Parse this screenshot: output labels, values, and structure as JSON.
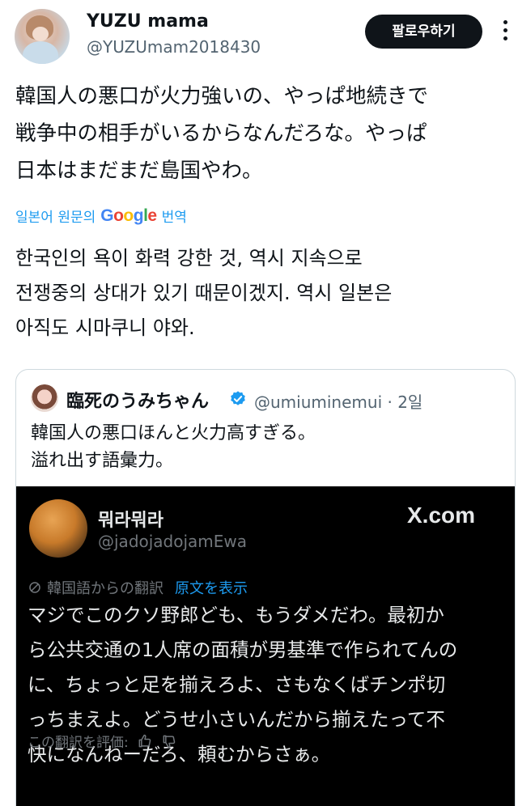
{
  "author": {
    "display_name": "YUZU mama",
    "handle": "@YUZUmam2018430",
    "follow_label": "팔로우하기"
  },
  "tweet": {
    "text_lines": [
      "韓国人の悪口が火力強いの、やっぱ地続きで",
      "戦争中の相手がいるからなんだろな。やっぱ",
      "日本はまだまだ島国やわ。"
    ],
    "translate_prefix": "일본어 원문의",
    "translate_suffix": "번역",
    "google": [
      "G",
      "o",
      "o",
      "g",
      "l",
      "e"
    ],
    "translated_lines": [
      "한국인의 욕이 화력 강한 것, 역시 지속으로",
      "전쟁중의 상대가 있기 때문이겠지. 역시 일본은",
      "아직도 시마쿠니 야와."
    ]
  },
  "quote": {
    "name": "臨死のうみちゃん",
    "handle_time": "@umiuminemui · 2일",
    "text_lines": [
      "韓国人の悪口ほんと火力高すぎる。",
      "溢れ出す語彙力。"
    ],
    "embedded": {
      "name": "뭐라뭐라",
      "handle": "@jadojadojamEwa",
      "site": "X.com",
      "translated_from": "韓国語からの翻訳",
      "show_original": "原文を表示",
      "body_lines": [
        "マジでこのクソ野郎ども、もうダメだわ。最初か",
        "ら公共交通の1人席の面積が男基準で作られてんの",
        "に、ちょっと足を揃えろよ、さもなくばチンポ切",
        "っちまえよ。どうせ小さいんだから揃えたって不",
        "快になんねーだろ、頼むからさぁ。"
      ],
      "rate_label": "この翻訳を評価:"
    }
  },
  "colors": {
    "link": "#1d9bf0",
    "muted": "#536471",
    "follow_bg": "#0f1419",
    "embed_bg": "#000000"
  },
  "icons": [
    "more-icon",
    "verified-icon",
    "translate-icon",
    "thumbs-up-icon",
    "thumbs-down-icon"
  ]
}
